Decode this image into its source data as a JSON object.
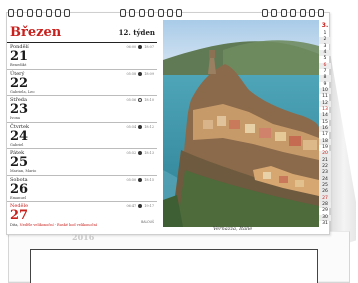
{
  "calendar": {
    "month": "Březen",
    "week": "12. týden",
    "year": "2016",
    "caption": "Vernazza, Itálie",
    "brand": "BALOUŠ",
    "days": [
      {
        "name": "Pondělí",
        "num": "21",
        "nameday": "Benedikt",
        "t1": "06:00",
        "t2": "18:07",
        "moon": "filled"
      },
      {
        "name": "Úterý",
        "num": "22",
        "nameday": "Gabriela, Leo",
        "t1": "05:58",
        "t2": "18:09",
        "moon": "filled"
      },
      {
        "name": "Středa",
        "num": "23",
        "nameday": "Ivona",
        "t1": "05:56",
        "t2": "18:10",
        "moon": "hollow"
      },
      {
        "name": "Čtvrtek",
        "num": "24",
        "nameday": "Gabriel",
        "t1": "05:54",
        "t2": "18:12",
        "moon": "filled"
      },
      {
        "name": "Pátek",
        "num": "25",
        "nameday": "Marian, Mario",
        "t1": "05:52",
        "t2": "18:13",
        "moon": "filled"
      },
      {
        "name": "Sobota",
        "num": "26",
        "nameday": "Emanuel",
        "t1": "05:50",
        "t2": "18:15",
        "moon": "filled"
      },
      {
        "name": "Neděle",
        "num": "27",
        "nameday": "Dita",
        "note_red": "Neděle velikonoční - Ruské hod velikonoční",
        "t1": "06:47",
        "t2": "19:17",
        "moon": "filled"
      }
    ],
    "mini": {
      "head": "3.",
      "numbers": [
        "1",
        "2",
        "3",
        "4",
        "5",
        "6",
        "7",
        "8",
        "9",
        "10",
        "11",
        "12",
        "13",
        "14",
        "15",
        "16",
        "17",
        "18",
        "19",
        "20",
        "21",
        "22",
        "23",
        "24",
        "25",
        "26",
        "27",
        "28",
        "29",
        "30",
        "31"
      ],
      "red": [
        "6",
        "13",
        "20",
        "27"
      ]
    }
  }
}
